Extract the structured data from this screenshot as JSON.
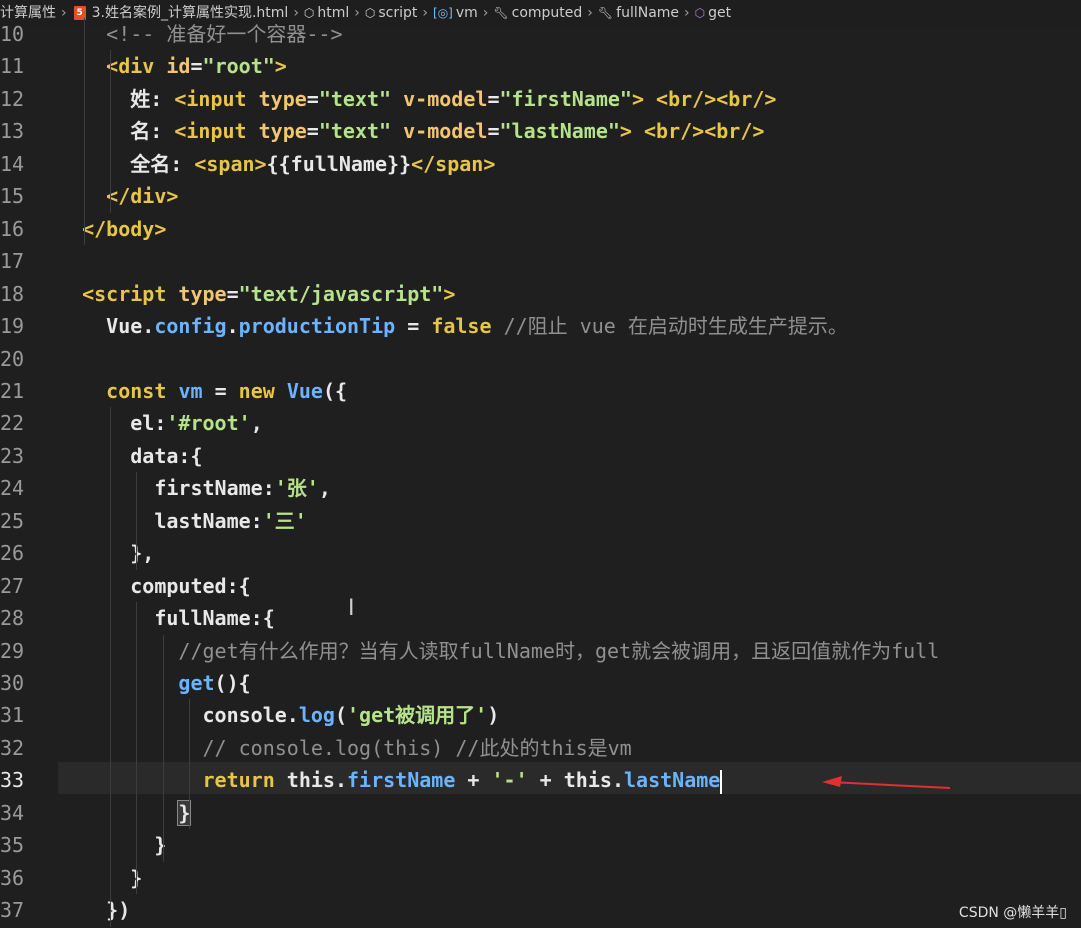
{
  "breadcrumb": {
    "items": [
      {
        "label": "计算属性",
        "icon": ""
      },
      {
        "label": "3.姓名案例_计算属性实现.html",
        "icon": "html5-icon"
      },
      {
        "label": "html",
        "icon": "cube-icon"
      },
      {
        "label": "script",
        "icon": "cube-icon"
      },
      {
        "label": "vm",
        "icon": "variable-icon"
      },
      {
        "label": "computed",
        "icon": "wrench-icon"
      },
      {
        "label": "fullName",
        "icon": "wrench-icon"
      },
      {
        "label": "get",
        "icon": "method-icon"
      }
    ]
  },
  "editor": {
    "current_line": "33",
    "lines": [
      {
        "num": "10",
        "tokens": [
          [
            "cm",
            "    <!-- 准备好一个容器-->"
          ]
        ]
      },
      {
        "num": "11",
        "tokens": [
          [
            "pun",
            "    "
          ],
          [
            "tag",
            "<div "
          ],
          [
            "attr",
            "id"
          ],
          [
            "pun",
            "="
          ],
          [
            "str",
            "\"root\""
          ],
          [
            "tag",
            ">"
          ]
        ]
      },
      {
        "num": "12",
        "tokens": [
          [
            "pun",
            "      姓: "
          ],
          [
            "tag",
            "<input "
          ],
          [
            "attr",
            "type"
          ],
          [
            "pun",
            "="
          ],
          [
            "str",
            "\"text\""
          ],
          [
            "pun",
            " "
          ],
          [
            "attr",
            "v-model"
          ],
          [
            "pun",
            "="
          ],
          [
            "str",
            "\"firstName\""
          ],
          [
            "tag",
            ">"
          ],
          [
            "pun",
            " "
          ],
          [
            "tag",
            "<br/><br/>"
          ]
        ]
      },
      {
        "num": "13",
        "tokens": [
          [
            "pun",
            "      名: "
          ],
          [
            "tag",
            "<input "
          ],
          [
            "attr",
            "type"
          ],
          [
            "pun",
            "="
          ],
          [
            "str",
            "\"text\""
          ],
          [
            "pun",
            " "
          ],
          [
            "attr",
            "v-model"
          ],
          [
            "pun",
            "="
          ],
          [
            "str",
            "\"lastName\""
          ],
          [
            "tag",
            ">"
          ],
          [
            "pun",
            " "
          ],
          [
            "tag",
            "<br/><br/>"
          ]
        ]
      },
      {
        "num": "14",
        "tokens": [
          [
            "pun",
            "      全名: "
          ],
          [
            "tag",
            "<span>"
          ],
          [
            "pun",
            "{{fullName}}"
          ],
          [
            "tag",
            "</span>"
          ]
        ]
      },
      {
        "num": "15",
        "tokens": [
          [
            "pun",
            "    "
          ],
          [
            "tag",
            "</div>"
          ]
        ]
      },
      {
        "num": "16",
        "tokens": [
          [
            "pun",
            "  "
          ],
          [
            "tag",
            "</body>"
          ]
        ]
      },
      {
        "num": "17",
        "tokens": []
      },
      {
        "num": "18",
        "tokens": [
          [
            "pun",
            "  "
          ],
          [
            "tag",
            "<script "
          ],
          [
            "attr",
            "type"
          ],
          [
            "pun",
            "="
          ],
          [
            "str",
            "\"text/javascript\""
          ],
          [
            "tag",
            ">"
          ]
        ]
      },
      {
        "num": "19",
        "tokens": [
          [
            "pun",
            "    "
          ],
          [
            "id",
            "Vue"
          ],
          [
            "pun",
            "."
          ],
          [
            "prop",
            "config"
          ],
          [
            "pun",
            "."
          ],
          [
            "prop",
            "productionTip"
          ],
          [
            "pun",
            " = "
          ],
          [
            "kw",
            "false"
          ],
          [
            "pun",
            " "
          ],
          [
            "cm",
            "//阻止 vue 在启动时生成生产提示。"
          ]
        ]
      },
      {
        "num": "20",
        "tokens": []
      },
      {
        "num": "21",
        "tokens": [
          [
            "pun",
            "    "
          ],
          [
            "kw",
            "const"
          ],
          [
            "pun",
            " "
          ],
          [
            "prop",
            "vm"
          ],
          [
            "pun",
            " = "
          ],
          [
            "kw",
            "new"
          ],
          [
            "pun",
            " "
          ],
          [
            "prop",
            "Vue"
          ],
          [
            "pun",
            "({"
          ]
        ]
      },
      {
        "num": "22",
        "tokens": [
          [
            "pun",
            "      "
          ],
          [
            "id",
            "el"
          ],
          [
            "pun",
            ":"
          ],
          [
            "str",
            "'#root'"
          ],
          [
            "pun",
            ","
          ]
        ]
      },
      {
        "num": "23",
        "tokens": [
          [
            "pun",
            "      "
          ],
          [
            "id",
            "data"
          ],
          [
            "pun",
            ":{"
          ]
        ]
      },
      {
        "num": "24",
        "tokens": [
          [
            "pun",
            "        "
          ],
          [
            "id",
            "firstName"
          ],
          [
            "pun",
            ":"
          ],
          [
            "str",
            "'张'"
          ],
          [
            "pun",
            ","
          ]
        ]
      },
      {
        "num": "25",
        "tokens": [
          [
            "pun",
            "        "
          ],
          [
            "id",
            "lastName"
          ],
          [
            "pun",
            ":"
          ],
          [
            "str",
            "'三'"
          ]
        ]
      },
      {
        "num": "26",
        "tokens": [
          [
            "pun",
            "      },"
          ]
        ]
      },
      {
        "num": "27",
        "tokens": [
          [
            "pun",
            "      "
          ],
          [
            "id",
            "computed"
          ],
          [
            "pun",
            ":{"
          ]
        ]
      },
      {
        "num": "28",
        "tokens": [
          [
            "pun",
            "        "
          ],
          [
            "id",
            "fullName"
          ],
          [
            "pun",
            ":{"
          ]
        ]
      },
      {
        "num": "29",
        "tokens": [
          [
            "pun",
            "          "
          ],
          [
            "cm",
            "//get有什么作用？当有人读取fullName时，get就会被调用，且返回值就作为full"
          ]
        ]
      },
      {
        "num": "30",
        "tokens": [
          [
            "pun",
            "          "
          ],
          [
            "prop",
            "get"
          ],
          [
            "pun",
            "(){"
          ]
        ]
      },
      {
        "num": "31",
        "tokens": [
          [
            "pun",
            "            "
          ],
          [
            "id",
            "console"
          ],
          [
            "pun",
            "."
          ],
          [
            "prop",
            "log"
          ],
          [
            "pun",
            "("
          ],
          [
            "str",
            "'get被调用了'"
          ],
          [
            "pun",
            ")"
          ]
        ]
      },
      {
        "num": "32",
        "tokens": [
          [
            "pun",
            "            "
          ],
          [
            "cm",
            "// console.log(this) //此处的this是vm"
          ]
        ]
      },
      {
        "num": "33",
        "tokens": [
          [
            "pun",
            "            "
          ],
          [
            "kw",
            "return"
          ],
          [
            "pun",
            " "
          ],
          [
            "id",
            "this"
          ],
          [
            "pun",
            "."
          ],
          [
            "prop",
            "firstName"
          ],
          [
            "pun",
            " + "
          ],
          [
            "str",
            "'-'"
          ],
          [
            "pun",
            " + "
          ],
          [
            "id",
            "this"
          ],
          [
            "pun",
            "."
          ],
          [
            "prop",
            "lastName"
          ]
        ]
      },
      {
        "num": "34",
        "tokens": [
          [
            "pun",
            "          "
          ],
          [
            "bracket",
            "}"
          ]
        ]
      },
      {
        "num": "35",
        "tokens": [
          [
            "pun",
            "        }"
          ]
        ]
      },
      {
        "num": "36",
        "tokens": [
          [
            "pun",
            "      }"
          ]
        ]
      },
      {
        "num": "37",
        "tokens": [
          [
            "pun",
            "    })"
          ]
        ]
      }
    ]
  },
  "watermark": "CSDN @懒羊羊▯"
}
